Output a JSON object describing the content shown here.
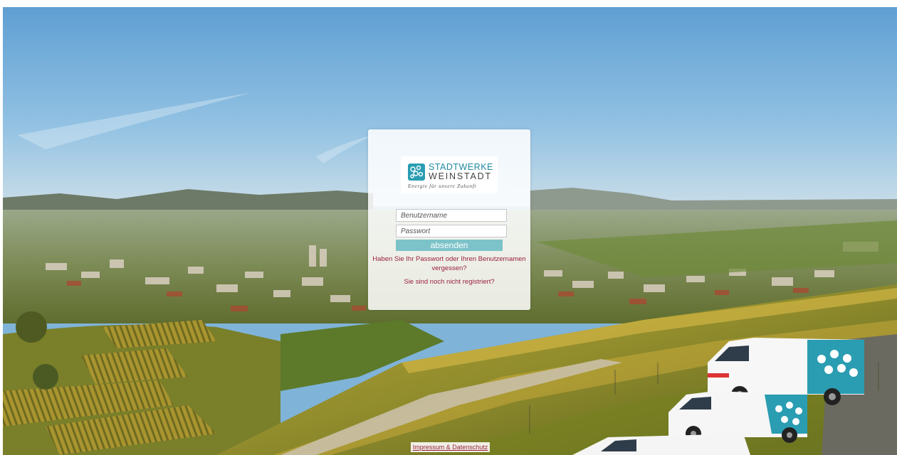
{
  "login": {
    "logo": {
      "brand_line1": "STADTWERKE",
      "brand_line2": "WEINSTADT",
      "tagline": "Energie für unsere Zukunft"
    },
    "username_placeholder": "Benutzername",
    "password_placeholder": "Passwort",
    "submit_label": "absenden",
    "forgot_link": "Haben Sie Ihr Passwort oder Ihren Benutzernamen vergessen?",
    "register_link": "Sie sind noch nicht registriert?"
  },
  "footer": {
    "imprint_link": "Impressum & Datenschutz"
  },
  "colors": {
    "accent_teal": "#7cc3c9",
    "brand_teal": "#2a9db2",
    "link_color": "#9a1f3c"
  },
  "icons": {
    "logo": "stadtwerke-logo-icon",
    "van_logo": "bubbles-logo-icon"
  }
}
